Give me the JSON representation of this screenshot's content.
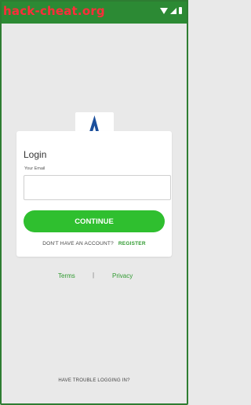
{
  "status_bar": {
    "watermark": "hack-cheat.org",
    "color": "#2c8a34"
  },
  "brand": {
    "logo": "a-letter-wave-logo",
    "colors": {
      "blue": "#1b4f9c",
      "green": "#4caf3a"
    }
  },
  "login": {
    "title": "Login",
    "email_label": "Your Email",
    "email_value": "",
    "email_placeholder": "",
    "continue_label": "CONTINUE",
    "no_account_text": "DON'T HAVE AN ACCOUNT?",
    "register_label": "REGISTER"
  },
  "footer": {
    "terms_label": "Terms",
    "divider": "|",
    "privacy_label": "Privacy",
    "trouble_label": "HAVE TROUBLE LOGGING IN?"
  },
  "colors": {
    "accent": "#2fbf2f",
    "link": "#2f9a2f",
    "background": "#e9e9e9"
  }
}
